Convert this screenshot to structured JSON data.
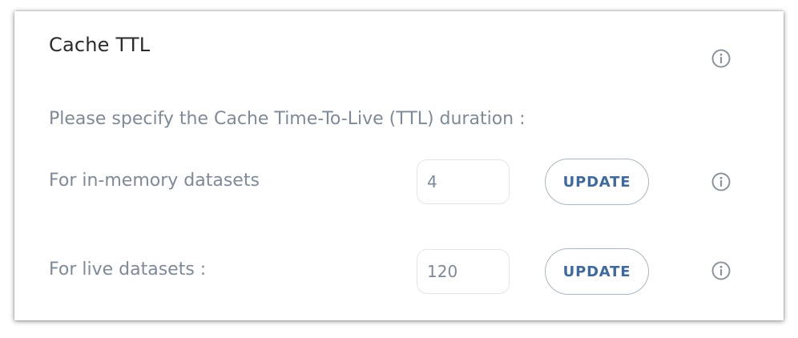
{
  "panel": {
    "title": "Cache TTL",
    "prompt": "Please specify the Cache Time-To-Live (TTL) duration :"
  },
  "rows": [
    {
      "label": "For in-memory datasets",
      "value": "4",
      "button_label": "UPDATE"
    },
    {
      "label": "For live datasets :",
      "value": "120",
      "button_label": "UPDATE"
    }
  ],
  "icons": {
    "header": "info-icon",
    "row": "info-icon"
  },
  "colors": {
    "title": "#2b2b2b",
    "label": "#7d8a99",
    "button_text": "#3d6aa3",
    "icon": "#8a949f"
  }
}
